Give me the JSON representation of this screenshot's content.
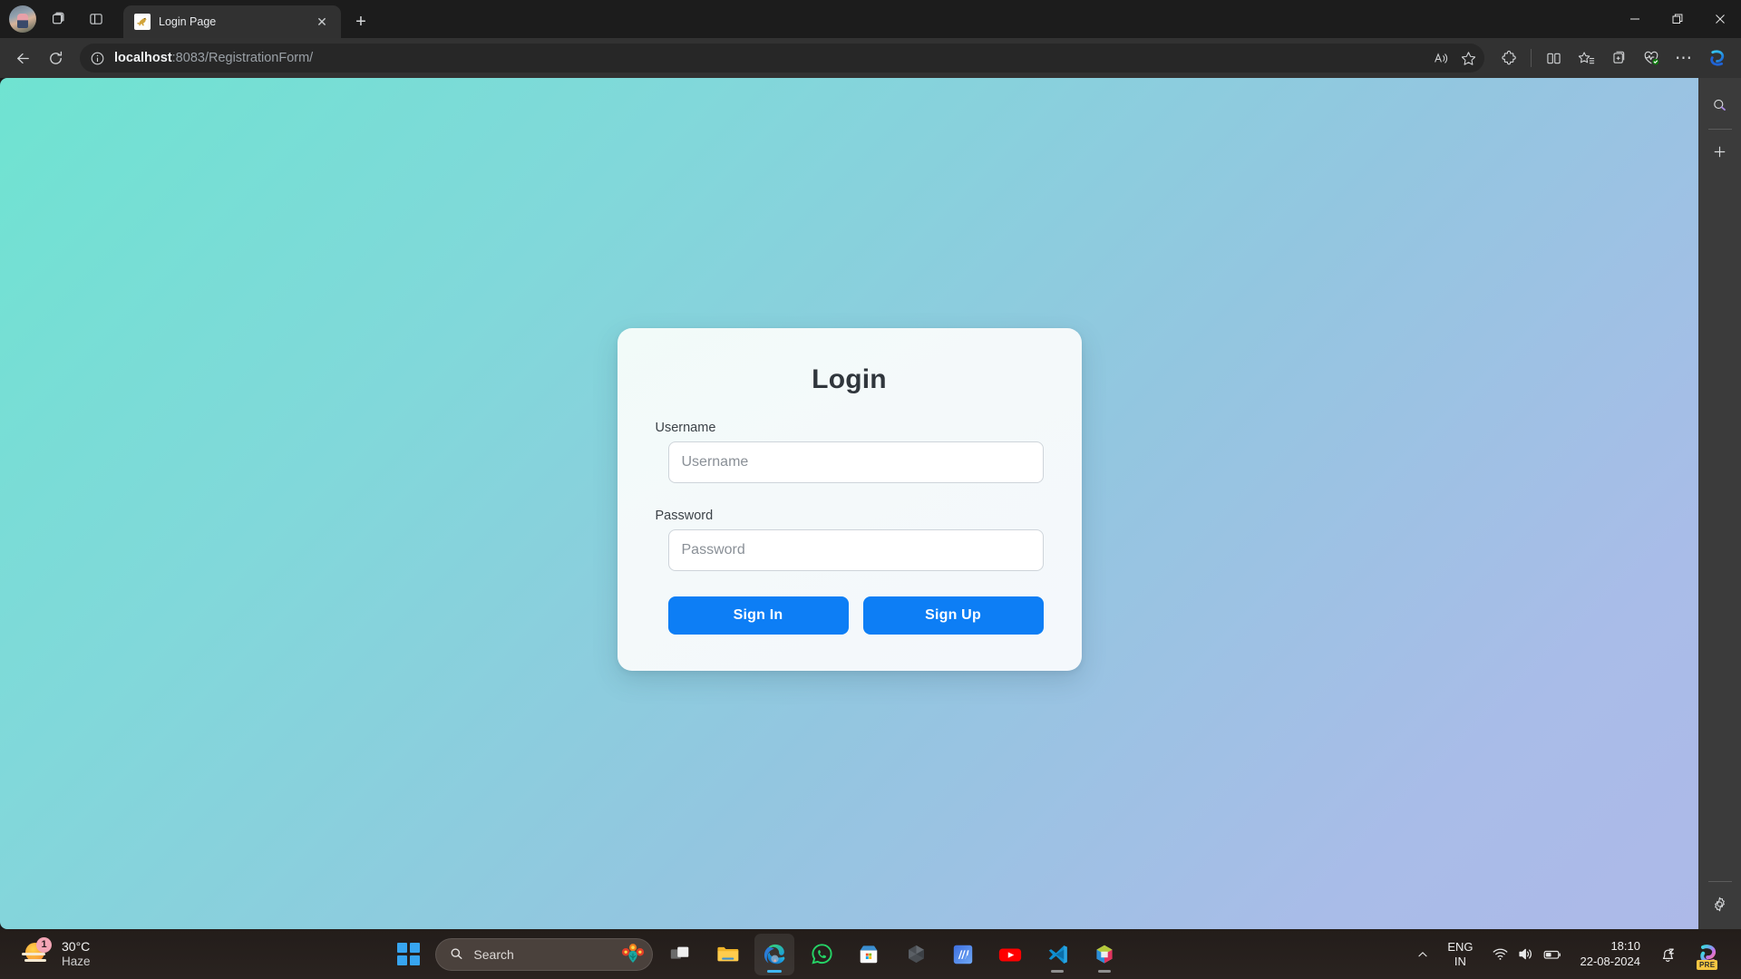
{
  "browser": {
    "tab": {
      "title": "Login Page",
      "favicon": "tomcat-icon",
      "close_label": "✕"
    },
    "newtab_label": "+",
    "window_controls": {
      "minimize": "—",
      "restore": "❐",
      "close": "✕"
    },
    "toolbar": {
      "back_label": "Back",
      "refresh_label": "Refresh",
      "url_host": "localhost",
      "url_rest": ":8083/RegistrationForm/",
      "url_full": "localhost:8083/RegistrationForm/",
      "read_aloud_label": "Read aloud",
      "favorite_label": "Add this page to favorites",
      "extensions_label": "Extensions",
      "split_screen_label": "Split screen",
      "collections_label": "Collections",
      "add_collection_label": "Add to collections",
      "browser_essentials_label": "Browser essentials",
      "settings_label": "⋯",
      "copilot_label": "Copilot"
    },
    "sidebar": {
      "search_label": "Search",
      "add_label": "+",
      "settings_label": "Sidebar settings"
    }
  },
  "page": {
    "background_from": "#6fe3d1",
    "background_to": "#adb9e8",
    "card": {
      "title": "Login",
      "fields": [
        {
          "label": "Username",
          "placeholder": "Username",
          "value": "",
          "type": "text",
          "name": "username"
        },
        {
          "label": "Password",
          "placeholder": "Password",
          "value": "",
          "type": "password",
          "name": "password"
        }
      ],
      "buttons": [
        {
          "label": "Sign In",
          "name": "sign-in"
        },
        {
          "label": "Sign Up",
          "name": "sign-up"
        }
      ],
      "accent_color": "#0d7ef5"
    }
  },
  "taskbar": {
    "weather": {
      "temperature": "30°C",
      "condition": "Haze",
      "badge": "1"
    },
    "search": {
      "placeholder": "Search",
      "value": ""
    },
    "start_label": "Start",
    "apps": [
      {
        "name": "task-view",
        "label": "Task View",
        "running": false,
        "active": false
      },
      {
        "name": "file-explorer",
        "label": "File Explorer",
        "running": false,
        "active": false
      },
      {
        "name": "microsoft-edge",
        "label": "Microsoft Edge",
        "running": true,
        "active": true
      },
      {
        "name": "whatsapp",
        "label": "WhatsApp",
        "running": false,
        "active": false
      },
      {
        "name": "microsoft-store",
        "label": "Microsoft Store",
        "running": false,
        "active": false
      },
      {
        "name": "unity-hub",
        "label": "Unity Hub",
        "running": false,
        "active": false
      },
      {
        "name": "autodesk",
        "label": "Autodesk",
        "running": false,
        "active": false
      },
      {
        "name": "youtube",
        "label": "YouTube",
        "running": false,
        "active": false
      },
      {
        "name": "vs-code",
        "label": "Visual Studio Code",
        "running": true,
        "active": false
      },
      {
        "name": "eclipse",
        "label": "Eclipse IDE",
        "running": true,
        "active": false
      }
    ],
    "tray": {
      "overflow_label": "Show hidden icons",
      "language_line1": "ENG",
      "language_line2": "IN",
      "wifi_label": "Network",
      "volume_label": "Volume",
      "battery_label": "Battery",
      "time": "18:10",
      "date": "22-08-2024",
      "notifications_label": "Notifications - Do not disturb",
      "copilot_label": "Copilot",
      "copilot_badge": "PRE"
    }
  }
}
